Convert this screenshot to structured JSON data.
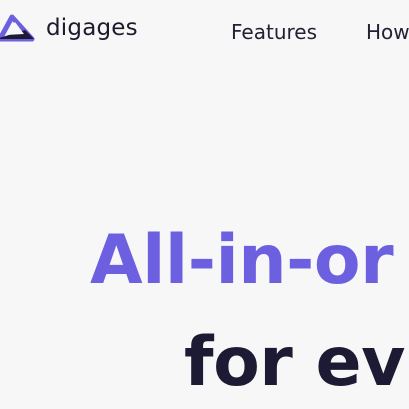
{
  "header": {
    "brand": "digages",
    "logo_icon": "triangle-logo-icon",
    "nav": [
      {
        "label": "Features"
      },
      {
        "label": "How"
      }
    ]
  },
  "hero": {
    "line1": "All-in-or",
    "line2": "for ev"
  },
  "colors": {
    "accent": "#6c5fe0",
    "dark": "#1d1b33",
    "background": "#f7f7f8"
  }
}
